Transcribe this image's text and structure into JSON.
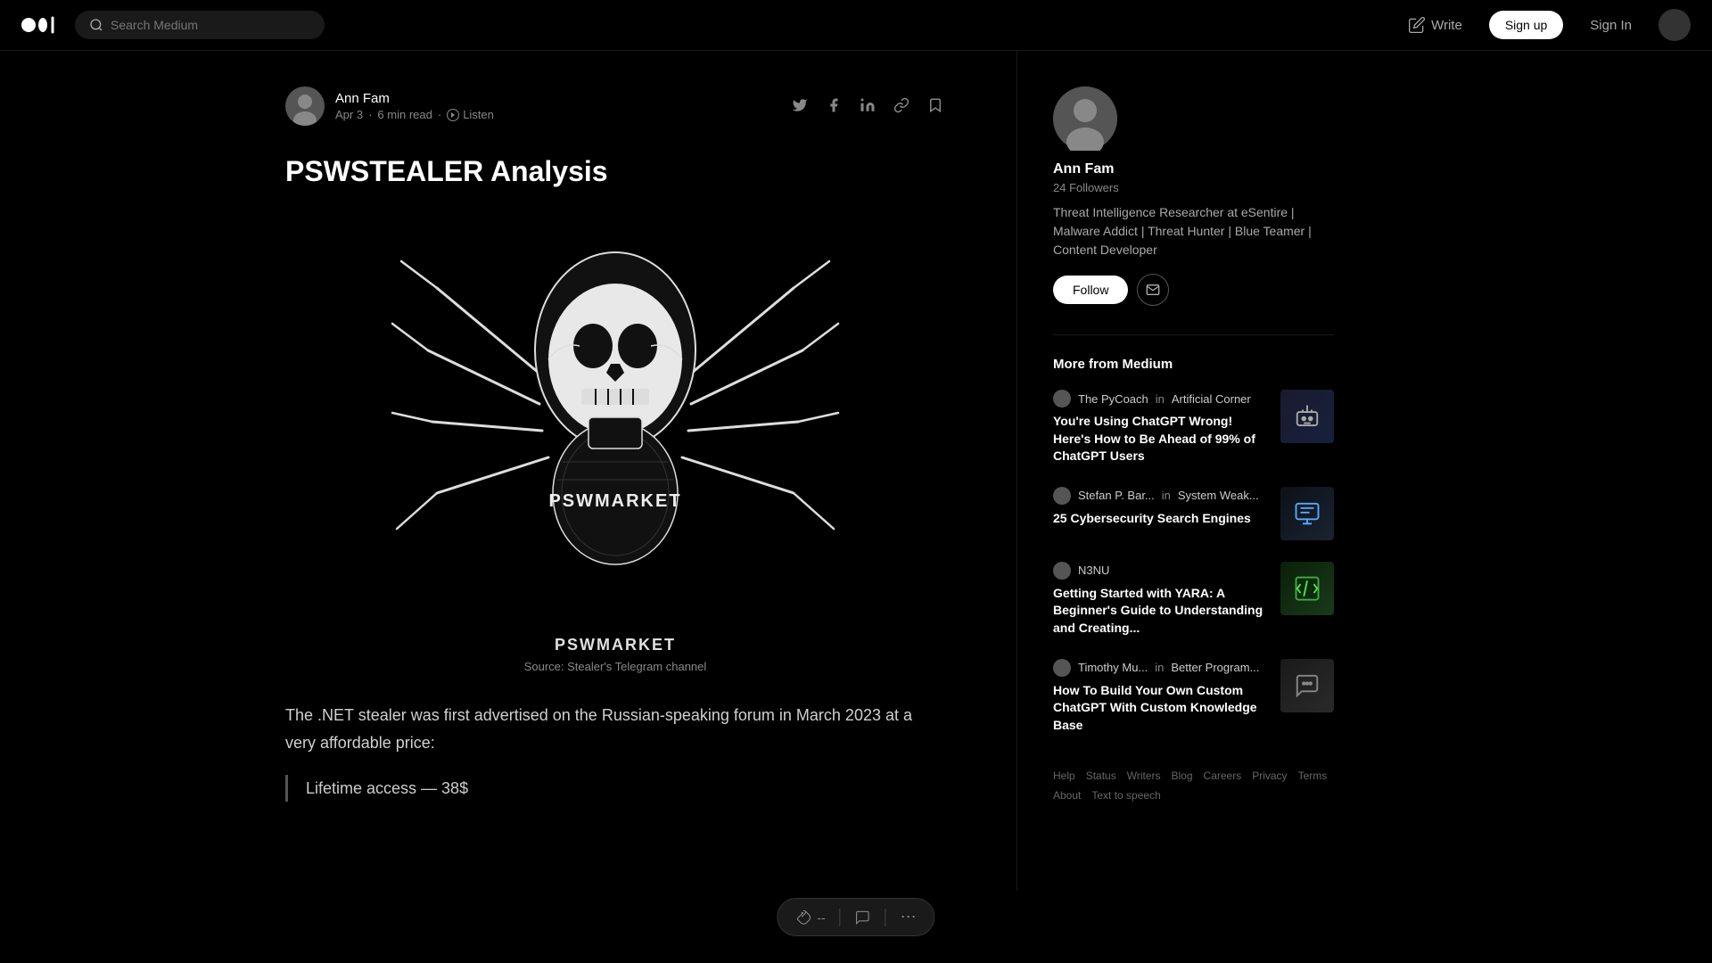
{
  "header": {
    "logo_alt": "Medium",
    "search_placeholder": "Search Medium",
    "write_label": "Write",
    "signup_label": "Sign up",
    "signin_label": "Sign In"
  },
  "article": {
    "author_name": "Ann Fam",
    "author_date": "Apr 3",
    "read_time": "6 min read",
    "listen_label": "Listen",
    "title": "PSWSTEALER Analysis",
    "image_caption_main": "PSWMARKET",
    "image_caption_sub": "Source: Stealer's Telegram channel",
    "body_text": "The .NET stealer was first advertised on the Russian-speaking forum in March 2023 at a very affordable price:",
    "quote_text": "Lifetime access — 38$",
    "social_links": [
      "twitter",
      "facebook",
      "linkedin",
      "copy-link"
    ]
  },
  "toolbar": {
    "clap_label": "--",
    "comment_label": "",
    "more_label": "⋯"
  },
  "sidebar": {
    "author_name": "Ann Fam",
    "author_followers": "24 Followers",
    "author_bio": "Threat Intelligence Researcher at eSentire | Malware Addict | Threat Hunter | Blue Teamer | Content Developer",
    "follow_label": "Follow",
    "more_from_medium_title": "More from Medium",
    "recommended": [
      {
        "author": "The PyCoach",
        "in_text": "in",
        "publication": "Artificial Corner",
        "title": "You're Using ChatGPT Wrong! Here's How to Be Ahead of 99% of ChatGPT Users",
        "thumb_type": "robot"
      },
      {
        "author": "Stefan P. Bar...",
        "in_text": "in",
        "publication": "System Weak...",
        "title": "25 Cybersecurity Search Engines",
        "thumb_type": "cyber"
      },
      {
        "author": "N3NU",
        "in_text": "",
        "publication": "",
        "title": "Getting Started with YARA: A Beginner's Guide to Understanding and Creating...",
        "thumb_type": "yara"
      },
      {
        "author": "Timothy Mu...",
        "in_text": "in",
        "publication": "Better Program...",
        "title": "How To Build Your Own Custom ChatGPT With Custom Knowledge Base",
        "thumb_type": "chatgpt"
      }
    ],
    "footer_links": [
      "Help",
      "Status",
      "Writers",
      "Blog",
      "Careers",
      "Privacy",
      "Terms",
      "About",
      "Text to speech"
    ]
  }
}
